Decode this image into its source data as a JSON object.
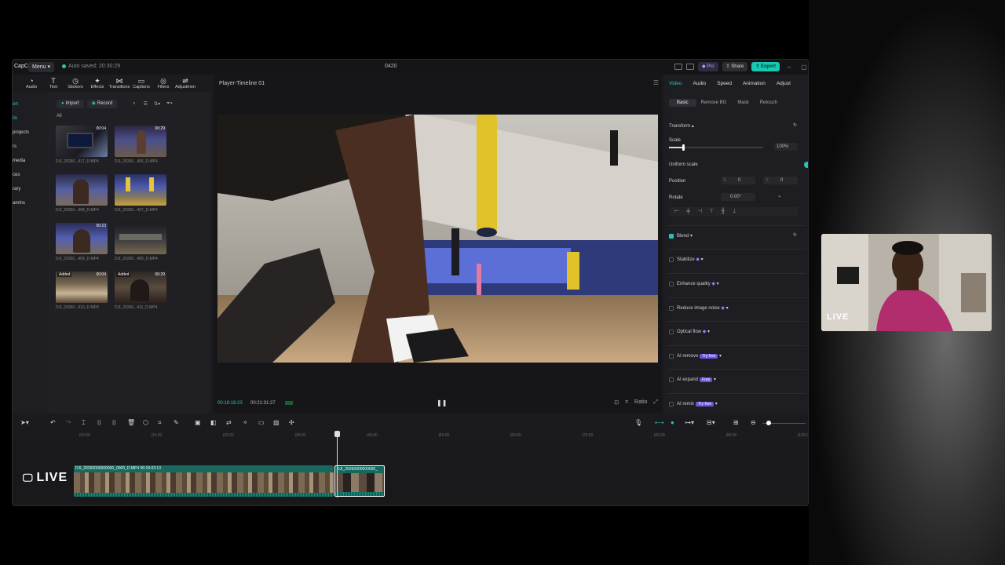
{
  "titlebar": {
    "logo": "CapCut",
    "menu_label": "Menu",
    "autosave": "Auto saved: 20:30:29",
    "project_title": "0420",
    "pro_label": "Pro",
    "share_label": "Share",
    "export_label": "Export"
  },
  "toolbar": {
    "items": [
      {
        "label": "Audio",
        "icon": "audio-icon"
      },
      {
        "label": "Text",
        "icon": "text-icon"
      },
      {
        "label": "Stickers",
        "icon": "sticker-icon"
      },
      {
        "label": "Effects",
        "icon": "effects-icon"
      },
      {
        "label": "Transitions",
        "icon": "transition-icon"
      },
      {
        "label": "Captions",
        "icon": "captions-icon"
      },
      {
        "label": "Filters",
        "icon": "filters-icon"
      },
      {
        "label": "Adjustmen",
        "icon": "adjust-icon"
      }
    ]
  },
  "leftnav": {
    "items": [
      "ort",
      "ilo",
      "projects",
      "rs",
      "media",
      "ces",
      "rary",
      "amlns"
    ]
  },
  "media": {
    "import_label": "Import",
    "record_label": "Record",
    "all_label": "All",
    "clips": [
      {
        "name": "DJI_20260...417_D.MP4",
        "duration": "00:04",
        "added": ""
      },
      {
        "name": "DJI_20260...406_D.MP4",
        "duration": "00:29",
        "added": ""
      },
      {
        "name": "DJI_20260...408_D.MP4",
        "duration": "",
        "added": ""
      },
      {
        "name": "DJI_20260...407_D.MP4",
        "duration": "",
        "added": ""
      },
      {
        "name": "DJI_20260...409_D.MP4",
        "duration": "00:23",
        "added": ""
      },
      {
        "name": "DJI_20260...409_D.MP4",
        "duration": "",
        "added": ""
      },
      {
        "name": "DJI_20260...410_D.MP4",
        "duration": "00:04",
        "added": "Added"
      },
      {
        "name": "DJI_20260...411_D.MP4",
        "duration": "00:29",
        "added": "Added"
      }
    ]
  },
  "player": {
    "title": "Player-Timeline 01",
    "current_time": "00:18:18:23",
    "total_time": "00:21:31:27",
    "ratio_label": "Ratio"
  },
  "props": {
    "tabs": [
      "Video",
      "Audio",
      "Speed",
      "Animation",
      "Adjust"
    ],
    "subtabs": [
      "Basic",
      "Remove BG",
      "Mask",
      "Retouch"
    ],
    "transform_label": "Transform",
    "scale_label": "Scale",
    "scale_value": "100%",
    "scale_fraction": 0.15,
    "uniform_label": "Uniform scale",
    "position_label": "Position",
    "pos_x_label": "X",
    "pos_x": "0",
    "pos_y_label": "Y",
    "pos_y": "0",
    "rotate_label": "Rotate",
    "rotate_value": "0.00°",
    "blend_label": "Blend",
    "stabilize_label": "Stabilize",
    "enhance_label": "Enhance quality",
    "noise_label": "Reduce image noise",
    "optical_label": "Optical flow",
    "ai_remove_label": "AI remove",
    "ai_remove_badge": "Try free",
    "ai_expand_label": "AI expand",
    "ai_expand_badge": "Free",
    "ai_remix_label": "AI remix",
    "ai_remix_badge": "Try free"
  },
  "ruler": {
    "ticks": [
      "00:00",
      "10:00",
      "20:00",
      "30:00",
      "40:00",
      "50:00",
      "60:00",
      "70:00",
      "80:00",
      "90:00",
      "100:00"
    ]
  },
  "timeline": {
    "clip_a_label": "DJI_20260000000000_0000_D.MP4   00:18:03:13",
    "clip_b_label": "DJI_20260000000000_"
  },
  "overlay": {
    "live_timeline": "LIVE",
    "live_cam": "LIVE"
  },
  "colors": {
    "accent": "#27c4b3",
    "export": "#17c9b2",
    "pro_badge": "#6b55e0"
  }
}
